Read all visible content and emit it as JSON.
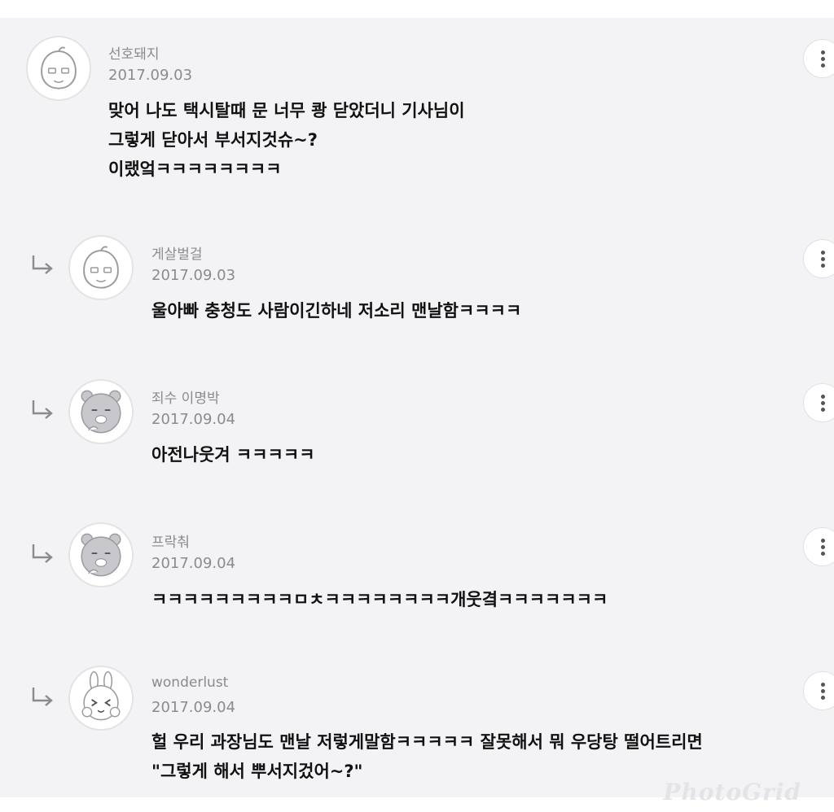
{
  "comments": [
    {
      "username": "선호돼지",
      "date": "2017.09.03",
      "lines": [
        "맞어 나도 택시탈때 문 너무 쾅 닫았더니 기사님이",
        "그렇게 닫아서 부서지것슈~?",
        "이랬엌ㅋㅋㅋㅋㅋㅋㅋㅋ"
      ],
      "avatar": "apeach-icon",
      "is_reply": false
    },
    {
      "username": "게살벌걸",
      "date": "2017.09.03",
      "lines": [
        "울아빠 충청도 사람이긴하네 저소리 맨날함ㅋㅋㅋㅋ"
      ],
      "avatar": "apeach-icon",
      "is_reply": true
    },
    {
      "username": "죄수 이명박",
      "date": "2017.09.04",
      "lines": [
        "아전나웃겨 ㅋㅋㅋㅋㅋ"
      ],
      "avatar": "ryan-icon",
      "is_reply": true
    },
    {
      "username": "프락춰",
      "date": "2017.09.04",
      "lines": [
        "ㅋㅋㅋㅋㅋㅋㅋㅋㅋㅁㅊㅋㅋㅋㅋㅋㅋㅋㅋ개웃곀ㅋㅋㅋㅋㅋㅋㅋ"
      ],
      "avatar": "ryan-icon",
      "is_reply": true
    },
    {
      "username": "wonderlust",
      "date": "2017.09.04",
      "lines": [
        "헐 우리 과장님도 맨날 저렇게말함ㅋㅋㅋㅋㅋ 잘못해서 뭐 우당탕 떨어트리면",
        "\"그렇게 해서 뿌서지겄어~?\""
      ],
      "avatar": "muzi-icon",
      "is_reply": true
    }
  ],
  "watermark": "PhotoGrid",
  "colors": {
    "background": "#f3f3f5",
    "meta_text": "#8a8a8f",
    "body_text": "#111111"
  }
}
